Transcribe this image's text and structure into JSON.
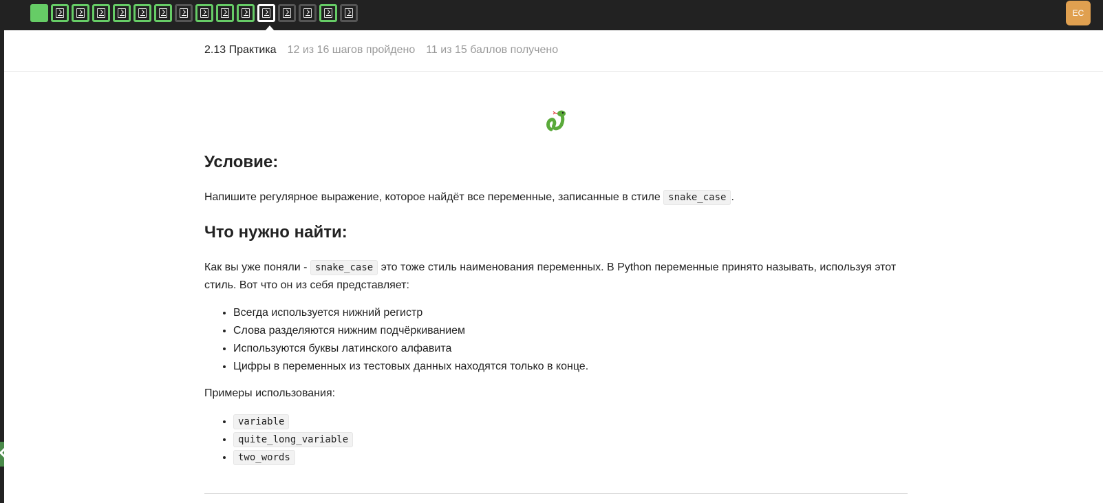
{
  "topbar": {
    "steps": [
      {
        "state": "done",
        "type": "first"
      },
      {
        "state": "done",
        "type": "code"
      },
      {
        "state": "done",
        "type": "code"
      },
      {
        "state": "done",
        "type": "code"
      },
      {
        "state": "done",
        "type": "code"
      },
      {
        "state": "done",
        "type": "code"
      },
      {
        "state": "done",
        "type": "code"
      },
      {
        "state": "todo",
        "type": "code"
      },
      {
        "state": "done",
        "type": "code"
      },
      {
        "state": "done",
        "type": "code"
      },
      {
        "state": "done",
        "type": "code"
      },
      {
        "state": "current",
        "type": "code"
      },
      {
        "state": "todo",
        "type": "code"
      },
      {
        "state": "todo",
        "type": "code"
      },
      {
        "state": "done",
        "type": "code"
      },
      {
        "state": "todo",
        "type": "code"
      }
    ],
    "avatar_initials": "EC",
    "colors": {
      "done": "#66cc66",
      "todo": "#555555",
      "current": "#ffffff",
      "avatar": "#e0a050"
    }
  },
  "lesson": {
    "title": "2.13 Практика",
    "steps_progress": "12 из 16 шагов пройдено",
    "score_progress": "11 из 15 баллов  получено"
  },
  "content": {
    "icon": "snake-icon",
    "heading1": "Условие:",
    "para1_before": "Напишите регулярное выражение, которое найдёт все переменные, записанные в стиле ",
    "para1_code": "snake_case",
    "para1_after": ".",
    "heading2": "Что нужно найти:",
    "para2_before": "Как вы уже поняли - ",
    "para2_code": "snake_case",
    "para2_after": " это тоже стиль наименования переменных. В Python переменные принято называть, используя этот стиль. Вот что он из себя представляет:",
    "rules": [
      "Всегда используется нижний регистр",
      "Слова разделяются нижним подчёркиванием",
      "Используются буквы латинского алфавита",
      "Цифры в переменных из тестовых данных находятся только в конце."
    ],
    "examples_label": "Примеры использования:",
    "examples": [
      "variable",
      "quite_long_variable",
      "two_words"
    ]
  }
}
